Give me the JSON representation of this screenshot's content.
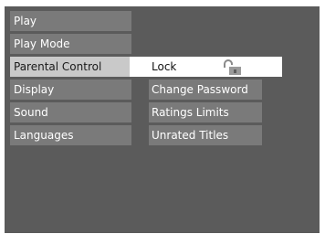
{
  "main_menu": {
    "items": [
      {
        "label": "Play"
      },
      {
        "label": "Play Mode"
      },
      {
        "label": "Parental Control",
        "selected": true
      },
      {
        "label": "Display"
      },
      {
        "label": "Sound"
      },
      {
        "label": "Languages"
      }
    ]
  },
  "sub_menu": {
    "items": [
      {
        "label": "Lock",
        "icon": "unlocked-padlock-icon",
        "highlighted": true
      },
      {
        "label": "Change Password"
      },
      {
        "label": "Ratings Limits"
      },
      {
        "label": "Unrated Titles"
      }
    ]
  },
  "colors": {
    "screen_bg": "#5b5b5b",
    "item_bg": "#7a7a7a",
    "selected_bg": "#c9c9c9",
    "highlight_bg": "#ffffff"
  }
}
